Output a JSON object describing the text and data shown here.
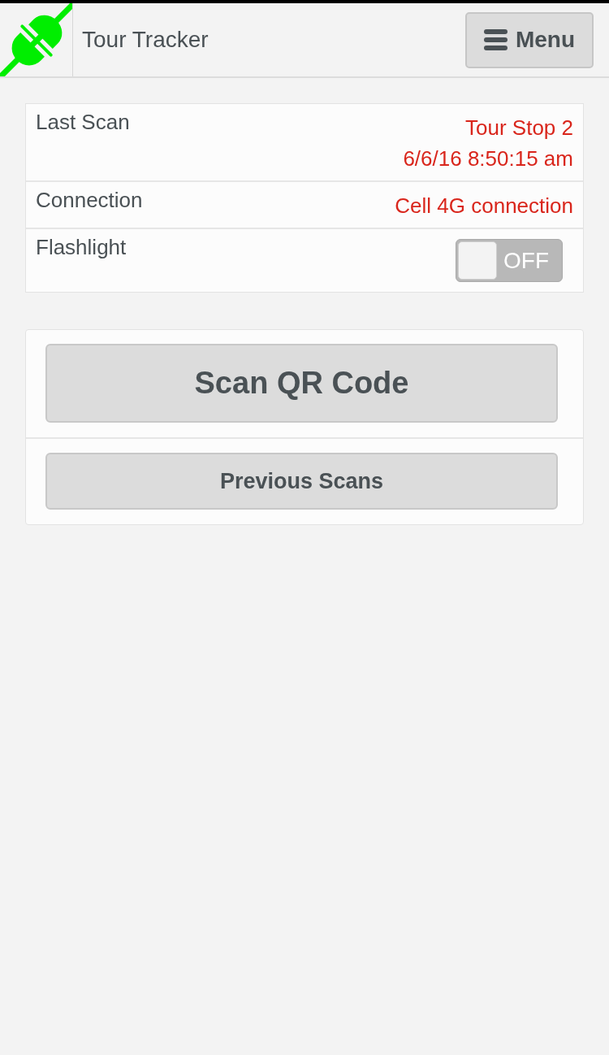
{
  "header": {
    "title": "Tour Tracker",
    "menu_button": {
      "label": "Menu"
    }
  },
  "status": [
    {
      "kind": "text",
      "label": "Last Scan",
      "lines": [
        "Tour Stop 2",
        "6/6/16 8:50:15 am"
      ]
    },
    {
      "kind": "text",
      "label": "Connection",
      "lines": [
        "Cell 4G connection"
      ]
    },
    {
      "kind": "toggle",
      "label": "Flashlight",
      "on": false,
      "state_label": "OFF"
    }
  ],
  "actions": [
    {
      "kind": "primary",
      "label": "Scan QR Code"
    },
    {
      "kind": "secondary",
      "label": "Previous Scans"
    }
  ]
}
